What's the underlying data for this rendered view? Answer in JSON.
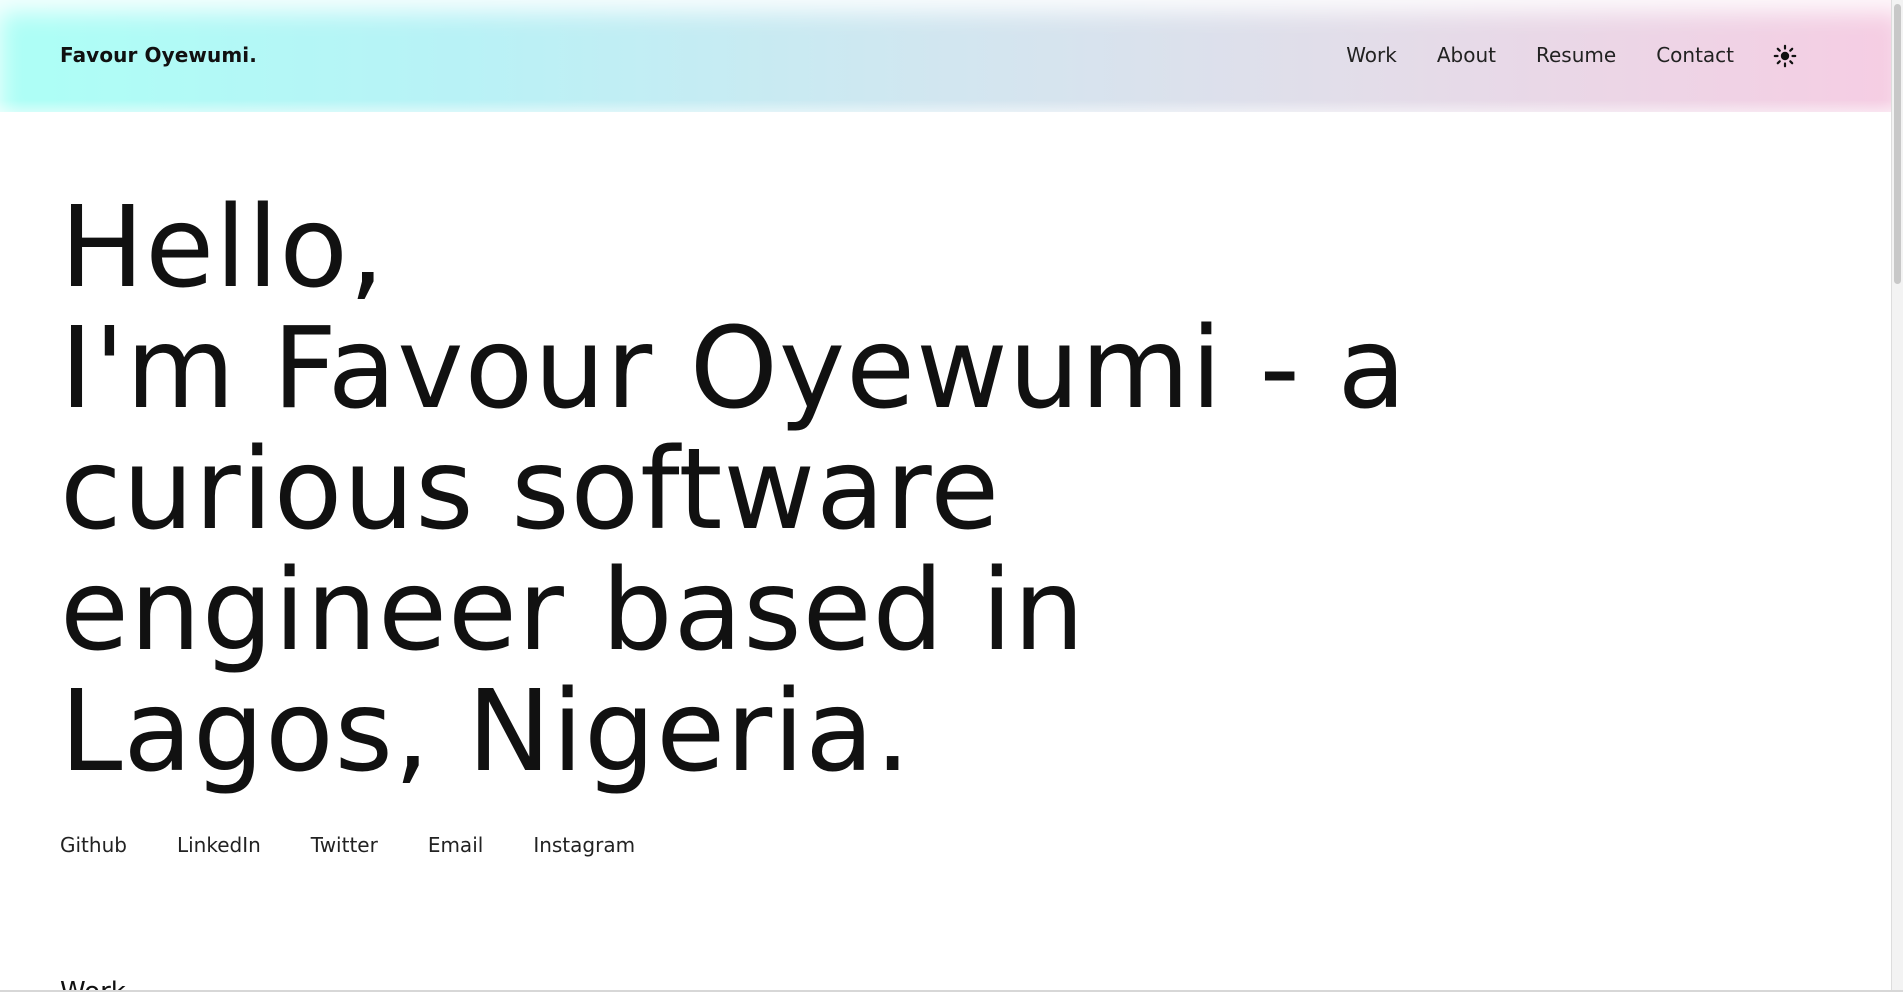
{
  "header": {
    "brand": "Favour Oyewumi.",
    "nav": [
      {
        "label": "Work"
      },
      {
        "label": "About"
      },
      {
        "label": "Resume"
      },
      {
        "label": "Contact"
      }
    ],
    "theme_icon": "sun-icon"
  },
  "hero": {
    "lines": [
      "Hello,",
      "I'm Favour Oyewumi - a",
      "curious software",
      "engineer based in",
      "Lagos, Nigeria."
    ]
  },
  "socials": [
    {
      "label": "Github"
    },
    {
      "label": "LinkedIn"
    },
    {
      "label": "Twitter"
    },
    {
      "label": "Email"
    },
    {
      "label": "Instagram"
    }
  ],
  "next_section": {
    "title": "Work"
  },
  "colors": {
    "gradient_start": "#adfff6",
    "gradient_middle": "#d2e6f0",
    "gradient_end": "#f6cde3",
    "text": "#111111"
  }
}
